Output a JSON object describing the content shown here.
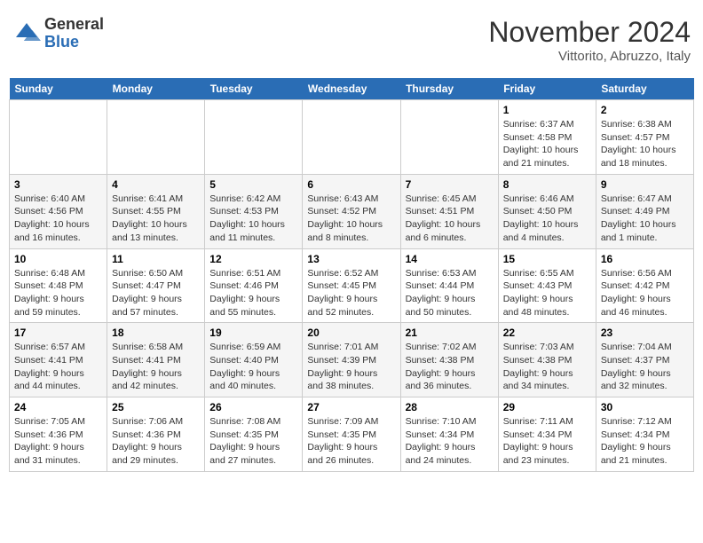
{
  "header": {
    "logo_general": "General",
    "logo_blue": "Blue",
    "month": "November 2024",
    "location": "Vittorito, Abruzzo, Italy"
  },
  "weekdays": [
    "Sunday",
    "Monday",
    "Tuesday",
    "Wednesday",
    "Thursday",
    "Friday",
    "Saturday"
  ],
  "weeks": [
    [
      {
        "day": "",
        "info": ""
      },
      {
        "day": "",
        "info": ""
      },
      {
        "day": "",
        "info": ""
      },
      {
        "day": "",
        "info": ""
      },
      {
        "day": "",
        "info": ""
      },
      {
        "day": "1",
        "info": "Sunrise: 6:37 AM\nSunset: 4:58 PM\nDaylight: 10 hours\nand 21 minutes."
      },
      {
        "day": "2",
        "info": "Sunrise: 6:38 AM\nSunset: 4:57 PM\nDaylight: 10 hours\nand 18 minutes."
      }
    ],
    [
      {
        "day": "3",
        "info": "Sunrise: 6:40 AM\nSunset: 4:56 PM\nDaylight: 10 hours\nand 16 minutes."
      },
      {
        "day": "4",
        "info": "Sunrise: 6:41 AM\nSunset: 4:55 PM\nDaylight: 10 hours\nand 13 minutes."
      },
      {
        "day": "5",
        "info": "Sunrise: 6:42 AM\nSunset: 4:53 PM\nDaylight: 10 hours\nand 11 minutes."
      },
      {
        "day": "6",
        "info": "Sunrise: 6:43 AM\nSunset: 4:52 PM\nDaylight: 10 hours\nand 8 minutes."
      },
      {
        "day": "7",
        "info": "Sunrise: 6:45 AM\nSunset: 4:51 PM\nDaylight: 10 hours\nand 6 minutes."
      },
      {
        "day": "8",
        "info": "Sunrise: 6:46 AM\nSunset: 4:50 PM\nDaylight: 10 hours\nand 4 minutes."
      },
      {
        "day": "9",
        "info": "Sunrise: 6:47 AM\nSunset: 4:49 PM\nDaylight: 10 hours\nand 1 minute."
      }
    ],
    [
      {
        "day": "10",
        "info": "Sunrise: 6:48 AM\nSunset: 4:48 PM\nDaylight: 9 hours\nand 59 minutes."
      },
      {
        "day": "11",
        "info": "Sunrise: 6:50 AM\nSunset: 4:47 PM\nDaylight: 9 hours\nand 57 minutes."
      },
      {
        "day": "12",
        "info": "Sunrise: 6:51 AM\nSunset: 4:46 PM\nDaylight: 9 hours\nand 55 minutes."
      },
      {
        "day": "13",
        "info": "Sunrise: 6:52 AM\nSunset: 4:45 PM\nDaylight: 9 hours\nand 52 minutes."
      },
      {
        "day": "14",
        "info": "Sunrise: 6:53 AM\nSunset: 4:44 PM\nDaylight: 9 hours\nand 50 minutes."
      },
      {
        "day": "15",
        "info": "Sunrise: 6:55 AM\nSunset: 4:43 PM\nDaylight: 9 hours\nand 48 minutes."
      },
      {
        "day": "16",
        "info": "Sunrise: 6:56 AM\nSunset: 4:42 PM\nDaylight: 9 hours\nand 46 minutes."
      }
    ],
    [
      {
        "day": "17",
        "info": "Sunrise: 6:57 AM\nSunset: 4:41 PM\nDaylight: 9 hours\nand 44 minutes."
      },
      {
        "day": "18",
        "info": "Sunrise: 6:58 AM\nSunset: 4:41 PM\nDaylight: 9 hours\nand 42 minutes."
      },
      {
        "day": "19",
        "info": "Sunrise: 6:59 AM\nSunset: 4:40 PM\nDaylight: 9 hours\nand 40 minutes."
      },
      {
        "day": "20",
        "info": "Sunrise: 7:01 AM\nSunset: 4:39 PM\nDaylight: 9 hours\nand 38 minutes."
      },
      {
        "day": "21",
        "info": "Sunrise: 7:02 AM\nSunset: 4:38 PM\nDaylight: 9 hours\nand 36 minutes."
      },
      {
        "day": "22",
        "info": "Sunrise: 7:03 AM\nSunset: 4:38 PM\nDaylight: 9 hours\nand 34 minutes."
      },
      {
        "day": "23",
        "info": "Sunrise: 7:04 AM\nSunset: 4:37 PM\nDaylight: 9 hours\nand 32 minutes."
      }
    ],
    [
      {
        "day": "24",
        "info": "Sunrise: 7:05 AM\nSunset: 4:36 PM\nDaylight: 9 hours\nand 31 minutes."
      },
      {
        "day": "25",
        "info": "Sunrise: 7:06 AM\nSunset: 4:36 PM\nDaylight: 9 hours\nand 29 minutes."
      },
      {
        "day": "26",
        "info": "Sunrise: 7:08 AM\nSunset: 4:35 PM\nDaylight: 9 hours\nand 27 minutes."
      },
      {
        "day": "27",
        "info": "Sunrise: 7:09 AM\nSunset: 4:35 PM\nDaylight: 9 hours\nand 26 minutes."
      },
      {
        "day": "28",
        "info": "Sunrise: 7:10 AM\nSunset: 4:34 PM\nDaylight: 9 hours\nand 24 minutes."
      },
      {
        "day": "29",
        "info": "Sunrise: 7:11 AM\nSunset: 4:34 PM\nDaylight: 9 hours\nand 23 minutes."
      },
      {
        "day": "30",
        "info": "Sunrise: 7:12 AM\nSunset: 4:34 PM\nDaylight: 9 hours\nand 21 minutes."
      }
    ]
  ]
}
